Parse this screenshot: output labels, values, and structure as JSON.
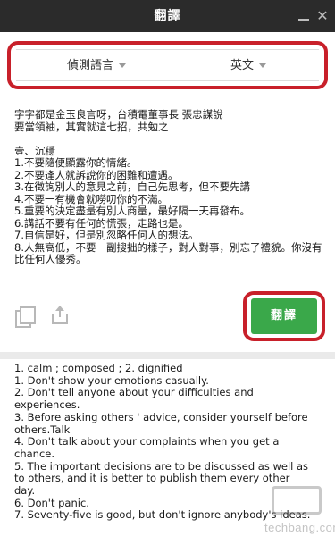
{
  "window": {
    "title": "翻譯"
  },
  "languages": {
    "source": "偵測語言",
    "target": "英文"
  },
  "source_text": "字字都是金玉良言呀，台積電董事長 張忠謀說\n要當領袖，其實就這七招，共勉之\n\n壹、沉穩\n1.不要隨便顯露你的情緒。\n2.不要逢人就訴說你的困難和遭遇。\n3.在徵詢別人的意見之前，自己先思考，但不要先講\n4.不要一有機會就嘮叨你的不滿。\n5.重要的決定盡量有別人商量，最好隔一天再發布。\n6.講話不要有任何的慌張，走路也是。\n7.自信是好，但是別忽略任何人的想法。\n8.人無高低，不要一副搜拙的樣子，對人對事，別忘了禮貌。你沒有比任何人優秀。",
  "translate_button": "翻譯",
  "result_lines": [
    "1. calm ; composed ; 2. dignified",
    "1. Don't show your emotions casually.",
    "2. Don't tell anyone about your difficulties and",
    "experiences.",
    "3. Before asking others ' advice, consider yourself before",
    "others.Talk",
    "4. Don't talk about your complaints when you get a",
    "chance.",
    "5. The important decisions are to be discussed as well as",
    "to others, and it is better to publish them every other",
    "day.",
    "6. Don't panic.",
    "7. Seventy-five is good, but don't ignore anybody's ideas."
  ],
  "watermark": "techbang.com",
  "icons": {
    "minimize": "minimize-icon",
    "close": "close-icon",
    "copy": "copy-icon",
    "share": "share-icon"
  }
}
